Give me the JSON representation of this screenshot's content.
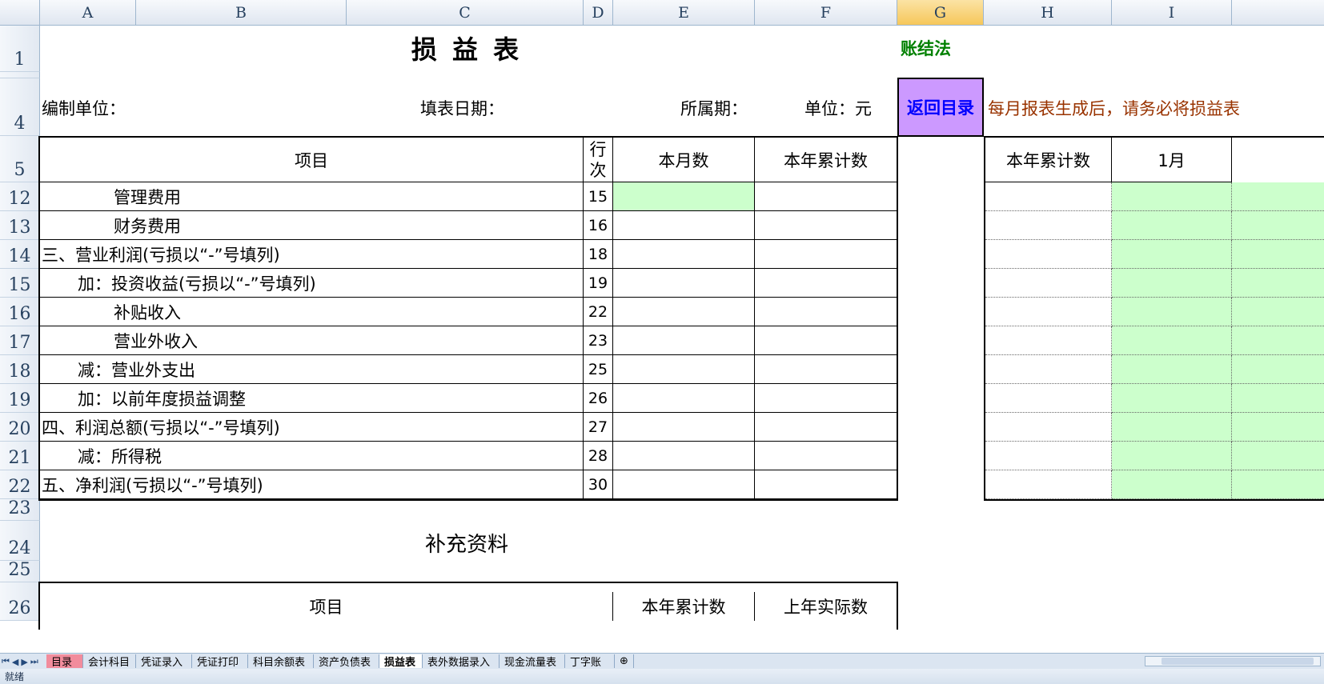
{
  "columns": [
    "A",
    "B",
    "C",
    "D",
    "E",
    "F",
    "G",
    "H",
    "I"
  ],
  "rows": {
    "r1": "1",
    "r4": "4",
    "r5": "5",
    "r12": "12",
    "r13": "13",
    "r14": "14",
    "r15": "15",
    "r16": "16",
    "r17": "17",
    "r18": "18",
    "r19": "19",
    "r20": "20",
    "r21": "21",
    "r22": "22",
    "r23": "23",
    "r24": "24",
    "r25": "25",
    "r26": "26"
  },
  "sheet": {
    "title": "损 益 表",
    "method": "账结法",
    "compile_unit": "编制单位：",
    "fill_date": "填表日期：",
    "period": "所属期：",
    "unit": "单位：元",
    "back_button": "返回目录",
    "notice": "每月报表生成后，请务必将损益表",
    "headers": {
      "item": "项目",
      "line": "行次",
      "month": "本月数",
      "year": "本年累计数"
    },
    "right_headers": {
      "year": "本年累计数",
      "jan": "1月"
    },
    "items": [
      {
        "label": "管理费用",
        "line": "15"
      },
      {
        "label": "财务费用",
        "line": "16"
      },
      {
        "label": "三、营业利润(亏损以“-”号填列)",
        "line": "18"
      },
      {
        "label": "加：投资收益(亏损以“-”号填列)",
        "line": "19"
      },
      {
        "label": "补贴收入",
        "line": "22"
      },
      {
        "label": "营业外收入",
        "line": "23"
      },
      {
        "label": "减：营业外支出",
        "line": "25"
      },
      {
        "label": "加：以前年度损益调整",
        "line": "26"
      },
      {
        "label": "四、利润总额(亏损以“-”号填列)",
        "line": "27"
      },
      {
        "label": "减：所得税",
        "line": "28"
      },
      {
        "label": "五、净利润(亏损以“-”号填列)",
        "line": "30"
      }
    ],
    "supplement_title": "补充资料",
    "supp_headers": {
      "item": "项目",
      "year": "本年累计数",
      "last_year": "上年实际数"
    }
  },
  "tabs": [
    "目录",
    "会计科目",
    "凭证录入",
    "凭证打印",
    "科目余额表",
    "资产负债表",
    "损益表",
    "表外数据录入",
    "现金流量表",
    "丁字账"
  ],
  "status": "就绪",
  "colors": {
    "green": "#008000",
    "purple_button": "#cc99ff",
    "blue_text": "#0000ff",
    "notice_red": "#993300",
    "input_green": "#ccffcc"
  }
}
